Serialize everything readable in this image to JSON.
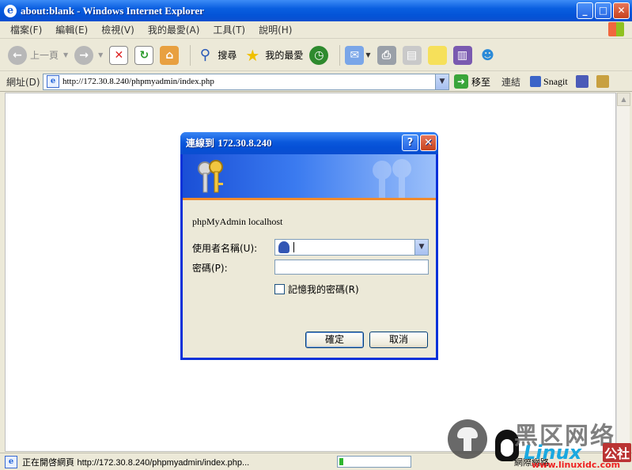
{
  "window": {
    "title": "about:blank - Windows Internet Explorer",
    "minimize": "_",
    "maximize": "□",
    "close": "✕"
  },
  "menu": {
    "items": [
      "檔案(F)",
      "編輯(E)",
      "檢視(V)",
      "我的最愛(A)",
      "工具(T)",
      "說明(H)"
    ]
  },
  "toolbar": {
    "back_label": "上一頁",
    "search_label": "搜尋",
    "favorites_label": "我的最愛"
  },
  "address": {
    "label": "網址(D)",
    "url": "http://172.30.8.240/phpmyadmin/index.php",
    "go_label": "移至",
    "links_label": "連結",
    "snagit_label": "Snagit"
  },
  "status": {
    "text_prefix": "正在開啓網頁",
    "text_url": "http://172.30.8.240/phpmyadmin/index.php...",
    "zone_label": "網際網路",
    "progress": 0.06
  },
  "dialog": {
    "title_prefix": "連線到",
    "title_host": "172.30.8.240",
    "help": "?",
    "close": "✕",
    "server_text": "phpMyAdmin localhost",
    "username_label": "使用者名稱(U):",
    "username_value": "",
    "password_label": "密碼(P):",
    "password_value": "",
    "remember_label": "記憶我的密碼(R)",
    "remember_checked": false,
    "ok_label": "確定",
    "cancel_label": "取消"
  },
  "watermark": {
    "cn": "黑区网络",
    "linux": "Linux",
    "she": "公社",
    "site": "www.linuxidc.com"
  }
}
